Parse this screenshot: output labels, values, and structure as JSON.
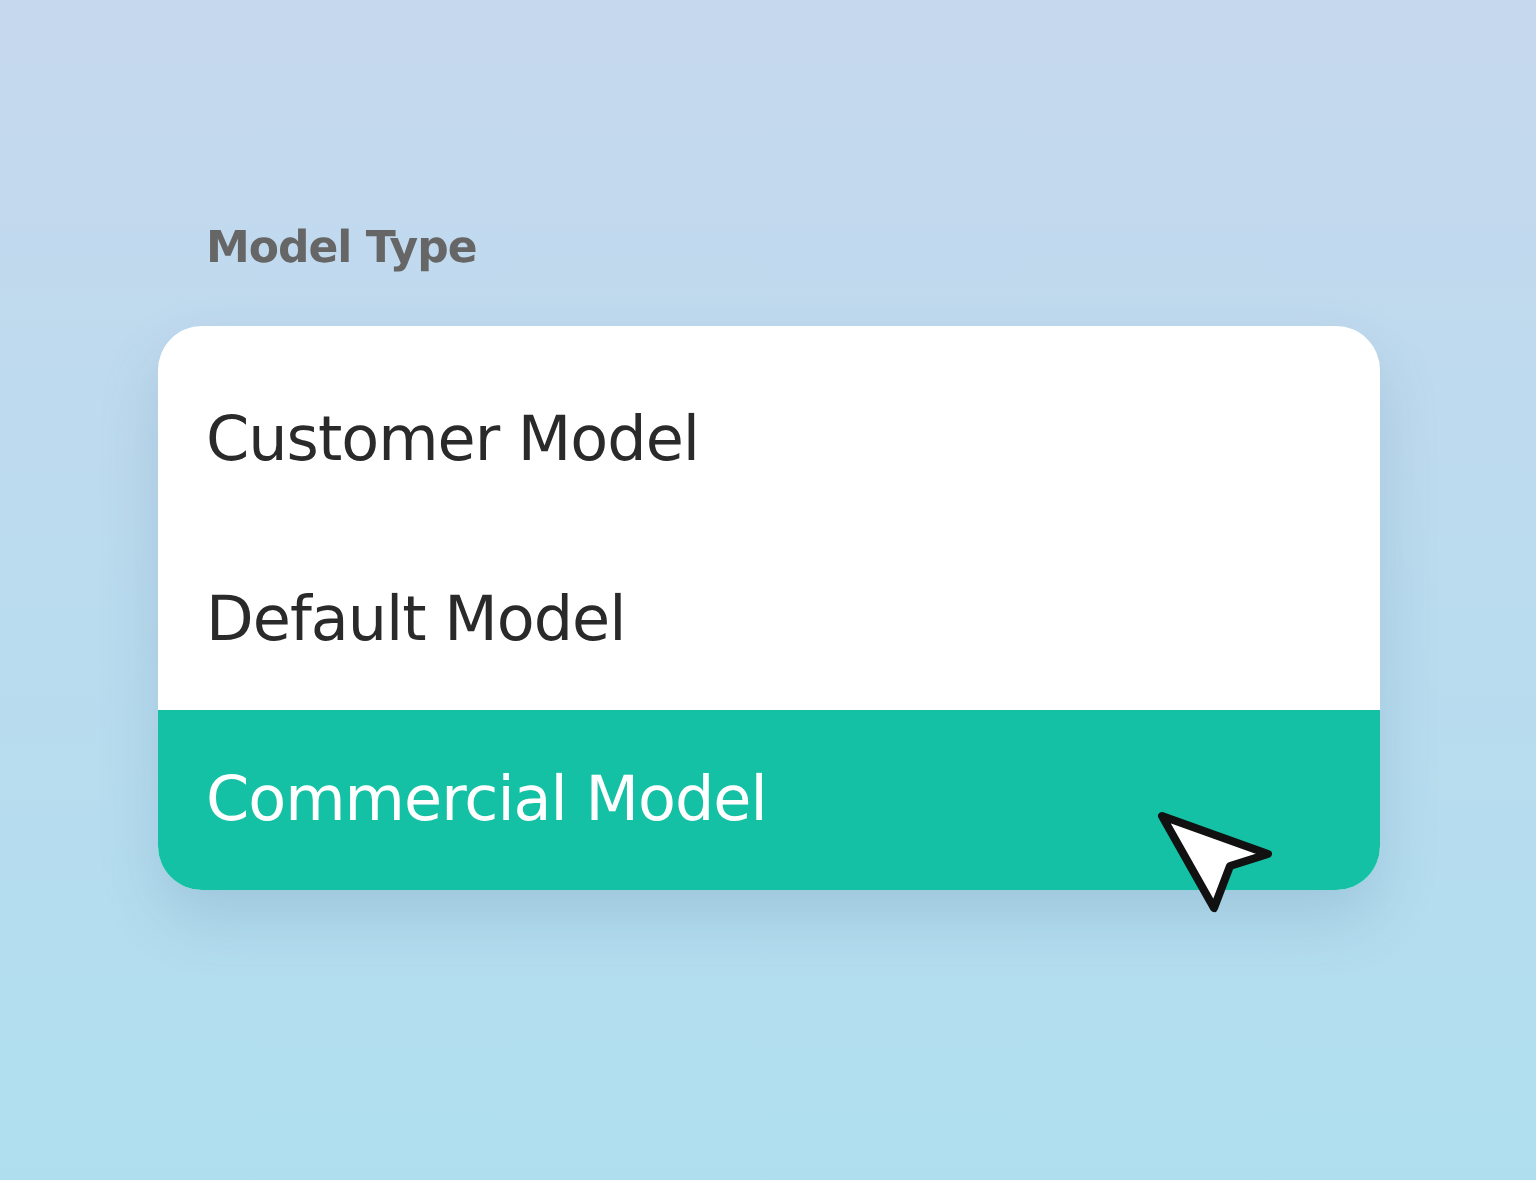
{
  "field": {
    "label": "Model Type"
  },
  "options": [
    {
      "label": "Customer Model",
      "selected": false
    },
    {
      "label": "Default Model",
      "selected": false
    },
    {
      "label": "Commercial Model",
      "selected": true
    }
  ]
}
